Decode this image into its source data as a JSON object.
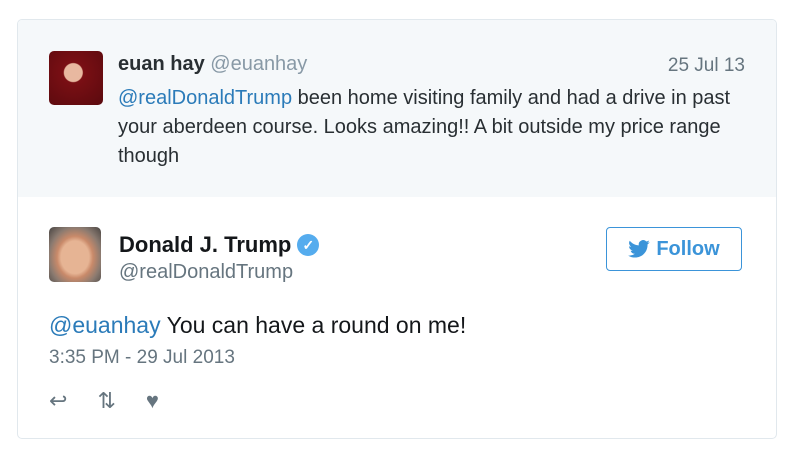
{
  "quoted": {
    "name": "euan hay",
    "handle": "@euanhay",
    "date": "25 Jul 13",
    "mention": "@realDonaldTrump",
    "text": " been home visiting family and had a drive in past your aberdeen course. Looks amazing!! A bit outside my price range though"
  },
  "tweet": {
    "name": "Donald J. Trump",
    "handle": "@realDonaldTrump",
    "follow_label": "Follow",
    "mention": "@euanhay",
    "text": " You can have a round on me!",
    "timestamp": "3:35 PM - 29 Jul 2013"
  },
  "icons": {
    "reply": "reply-icon",
    "retweet": "retweet-icon",
    "like": "heart-icon",
    "verified": "verified-icon",
    "bird": "twitter-bird-icon"
  },
  "colors": {
    "link": "#2b7bb9",
    "follow": "#3b94d9",
    "verified": "#55acee"
  }
}
